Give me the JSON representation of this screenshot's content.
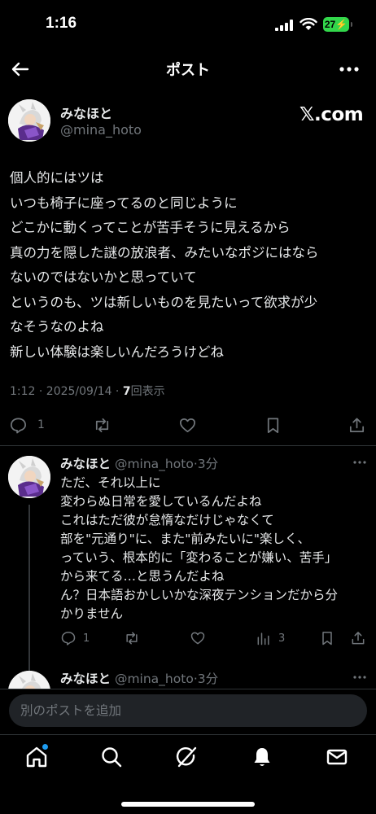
{
  "status_bar": {
    "time": "1:16",
    "battery": "27"
  },
  "header": {
    "title": "ポスト"
  },
  "main_post": {
    "author_name": "みなほと",
    "author_handle": "@mina_hoto",
    "source_label": "𝕏.com",
    "lines": [
      "個人的にはツは",
      "いつも椅子に座ってるのと同じように",
      "どこかに動くってことが苦手そうに見えるから",
      "真の力を隠した謎の放浪者、みたいなポジにはなら",
      "ないのではないかと思っていて",
      "というのも、ツは新しいものを見たいって欲求が少",
      "なそうなのよね",
      "新しい体験は楽しいんだろうけどね"
    ],
    "meta_time": "1:12 · 2025/09/14 · ",
    "meta_views_count": "7",
    "meta_views_label": "回表示",
    "reply_count": "1"
  },
  "replies": [
    {
      "author_name": "みなほと",
      "author_handle": "@mina_hoto",
      "age": "·3分",
      "lines": [
        "ただ、それ以上に",
        "変わらぬ日常を愛しているんだよね",
        "これはただ彼が怠惰なだけじゃなくて",
        "部を\"元通り\"に、また\"前みたいに\"楽しく、",
        "っていう、根本的に「変わることが嫌い、苦手」",
        "から来てる…と思うんだよね",
        "ん？日本語おかしいかな深夜テンションだから分",
        "かりません"
      ],
      "reply_count": "1",
      "view_count": "3"
    },
    {
      "author_name": "みなほと",
      "author_handle": "@mina_hoto",
      "age": "·3分"
    }
  ],
  "compose": {
    "placeholder": "別のポストを追加"
  },
  "tabs": [
    "home",
    "search",
    "grok",
    "notifications",
    "messages"
  ],
  "colors": {
    "accent": "#1d9bf0",
    "background": "#000000",
    "muted": "#71767b",
    "battery": "#32d74b"
  }
}
